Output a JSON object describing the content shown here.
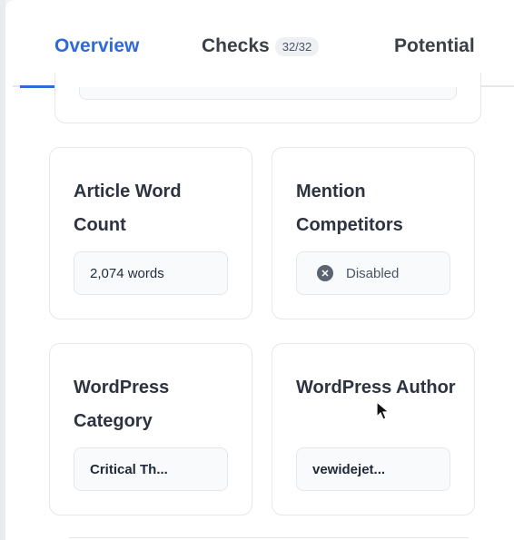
{
  "tabs": {
    "overview": "Overview",
    "checks": "Checks",
    "checks_badge": "32/32",
    "potential": "Potential"
  },
  "cards": [
    {
      "title": "Article Word Count",
      "value": "2,074 words"
    },
    {
      "title": "Mention Competitors",
      "value": "Disabled",
      "icon": "x-circle-icon"
    },
    {
      "title": "WordPress Category",
      "value": "Critical Th..."
    },
    {
      "title": "WordPress Author",
      "value": "vewidejet..."
    }
  ],
  "colors": {
    "accent": "#2f6bd8",
    "text": "#2d3340",
    "border": "#e5e7eb"
  }
}
